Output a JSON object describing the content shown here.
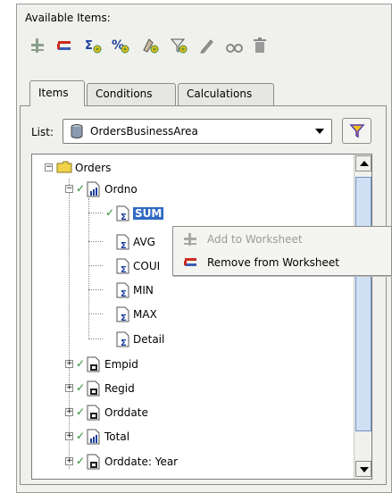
{
  "panel": {
    "available_items_label": "Available Items:"
  },
  "toolbar": {
    "icons": [
      "add-to-worksheet-icon",
      "remove-from-worksheet-icon",
      "new-calculation-icon",
      "new-percentage-icon",
      "new-condition-icon",
      "new-filter-icon",
      "edit-icon",
      "show-properties-icon",
      "delete-icon"
    ]
  },
  "tabs": [
    {
      "label": "Items",
      "active": true
    },
    {
      "label": "Conditions",
      "active": false
    },
    {
      "label": "Calculations",
      "active": false
    }
  ],
  "list": {
    "label": "List:",
    "selected": "OrdersBusinessArea"
  },
  "tree": {
    "root": "Orders",
    "items": [
      {
        "label": "Ordno",
        "checked": true,
        "expanded": true,
        "children": [
          {
            "label": "SUM",
            "checked": true,
            "selected": true
          },
          {
            "label": "AVG"
          },
          {
            "label": "COUI"
          },
          {
            "label": "MIN"
          },
          {
            "label": "MAX"
          },
          {
            "label": "Detail"
          }
        ]
      },
      {
        "label": "Empid",
        "checked": true
      },
      {
        "label": "Regid",
        "checked": true
      },
      {
        "label": "Orddate",
        "checked": true
      },
      {
        "label": "Total",
        "checked": true
      },
      {
        "label": "Orddate: Year",
        "checked": true
      }
    ]
  },
  "context_menu": {
    "items": [
      {
        "label": "Add to Worksheet",
        "enabled": false
      },
      {
        "label": "Remove from Worksheet",
        "enabled": true
      }
    ]
  },
  "colors": {
    "selection": "#316ac5",
    "remove_red": "#cc2a1e",
    "add_green": "#3a8a3a"
  }
}
